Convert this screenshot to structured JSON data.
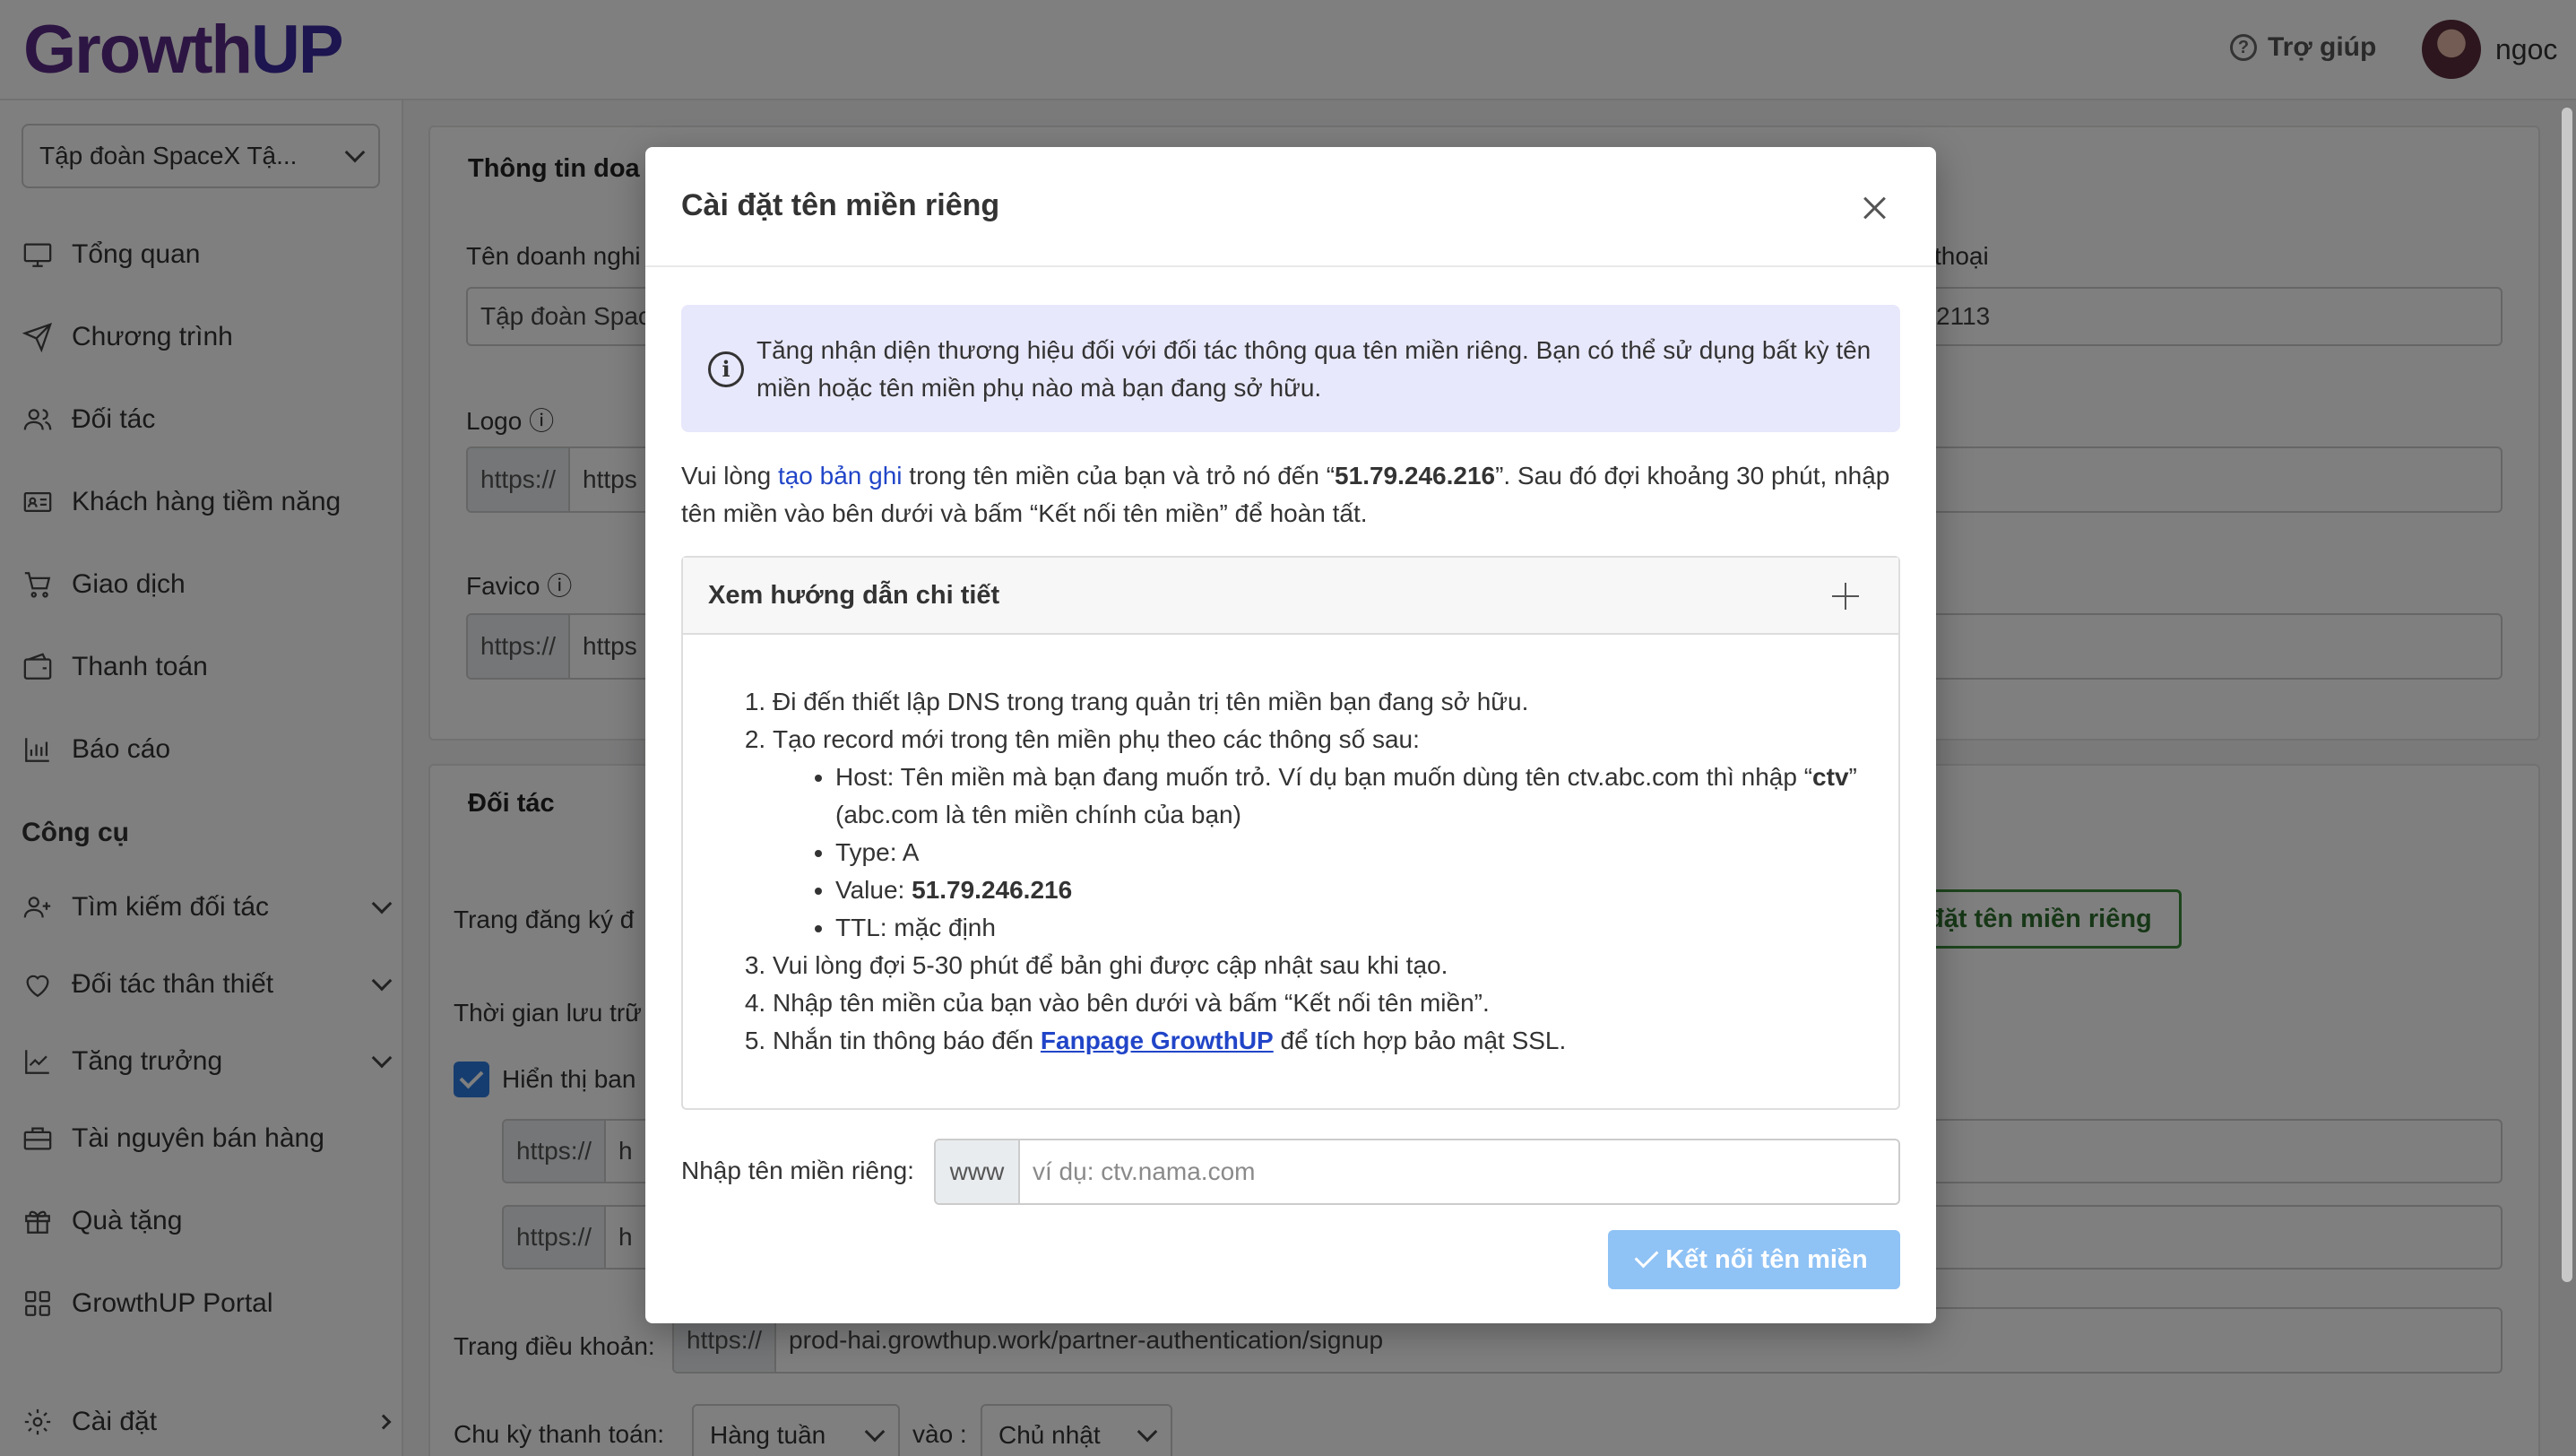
{
  "header": {
    "logo_main": "Growth",
    "logo_up": "UP",
    "help_label": "Trợ giúp",
    "user_name": "ngoc"
  },
  "sidebar": {
    "org_select": "Tập đoàn SpaceX Tậ...",
    "items": [
      {
        "label": "Tổng quan",
        "icon": "monitor-icon"
      },
      {
        "label": "Chương trình",
        "icon": "send-icon"
      },
      {
        "label": "Đối tác",
        "icon": "users-icon"
      },
      {
        "label": "Khách hàng tiềm năng",
        "icon": "id-card-icon"
      },
      {
        "label": "Giao dịch",
        "icon": "cart-icon"
      },
      {
        "label": "Thanh toán",
        "icon": "wallet-icon"
      },
      {
        "label": "Báo cáo",
        "icon": "bar-chart-icon"
      }
    ],
    "tools_section": "Công cụ",
    "tools": [
      {
        "label": "Tìm kiếm đối tác",
        "icon": "user-plus-icon"
      },
      {
        "label": "Đối tác thân thiết",
        "icon": "heart-icon"
      },
      {
        "label": "Tăng trưởng",
        "icon": "trend-icon"
      },
      {
        "label": "Tài nguyên bán hàng",
        "icon": "briefcase-icon"
      },
      {
        "label": "Quà tặng",
        "icon": "gift-icon"
      },
      {
        "label": "GrowthUP Portal",
        "icon": "grid-icon"
      }
    ],
    "settings": "Cài đặt"
  },
  "background": {
    "business_card_title": "Thông tin doa",
    "business_name_label": "Tên doanh nghi",
    "business_name_value": "Tập đoàn Spac",
    "phone_label": "thoại",
    "phone_value": "2113",
    "logo_label": "Logo",
    "logo_prefix": "https://",
    "logo_value": "https",
    "favico_label": "Favico",
    "favico_prefix": "https://",
    "favico_value": "https",
    "partner_card_title": "Đối tác",
    "signup_label": "Trang đăng ký đ",
    "custom_domain_btn": "đặt tên miền riêng",
    "storage_label": "Thời gian lưu trữ",
    "show_label": "Hiển thị ban",
    "url_prefix_1": "https://",
    "url_value_1": "h",
    "url_prefix_2": "https://",
    "url_value_2": "h",
    "terms_label": "Trang điều khoản:",
    "terms_prefix": "https://",
    "terms_value": "prod-hai.growthup.work/partner-authentication/signup",
    "cycle_label": "Chu kỳ thanh toán:",
    "cycle_value": "Hàng tuần",
    "on_label": "vào :",
    "day_value": "Chủ nhật"
  },
  "modal": {
    "title": "Cài đặt tên miền riêng",
    "info_text": "Tăng nhận diện thương hiệu đối với đối tác thông qua tên miền riêng. Bạn có thể sử dụng bất kỳ tên miền hoặc tên miền phụ nào mà bạn đang sở hữu.",
    "intro_1": "Vui lòng ",
    "intro_link": "tạo bản ghi",
    "intro_2": " trong tên miền của bạn và trỏ nó đến “",
    "ip": "51.79.246.216",
    "intro_3": "”. Sau đó đợi khoảng 30 phút, nhập tên miền vào bên dưới và bấm “Kết nối tên miền” để hoàn tất.",
    "guide_title": "Xem hướng dẫn chi tiết",
    "step1": "Đi đến thiết lập DNS trong trang quản trị tên miền bạn đang sở hữu.",
    "step2": "Tạo record mới trong tên miền phụ theo các thông số sau:",
    "host_1": "Host: Tên miền mà bạn đang muốn trỏ. Ví dụ bạn muốn dùng tên ctv.abc.com thì nhập “",
    "host_bold": "ctv",
    "host_2": "” (abc.com là tên miền chính của bạn)",
    "type": "Type: A",
    "value_label": "Value: ",
    "value_ip": "51.79.246.216",
    "ttl": "TTL: mặc định",
    "step3": "Vui lòng đợi 5-30 phút để bản ghi được cập nhật sau khi tạo.",
    "step4": "Nhập tên miền của bạn vào bên dưới và bấm “Kết nối tên miền”.",
    "step5_1": "Nhắn tin thông báo đến ",
    "step5_link": "Fanpage GrowthUP",
    "step5_2": " để tích hợp bảo mật SSL.",
    "domain_label": "Nhập tên miền riêng:",
    "domain_prefix": "www",
    "domain_placeholder": "ví dụ: ctv.nama.com",
    "domain_value": "",
    "connect_btn": "Kết nối tên miền"
  }
}
